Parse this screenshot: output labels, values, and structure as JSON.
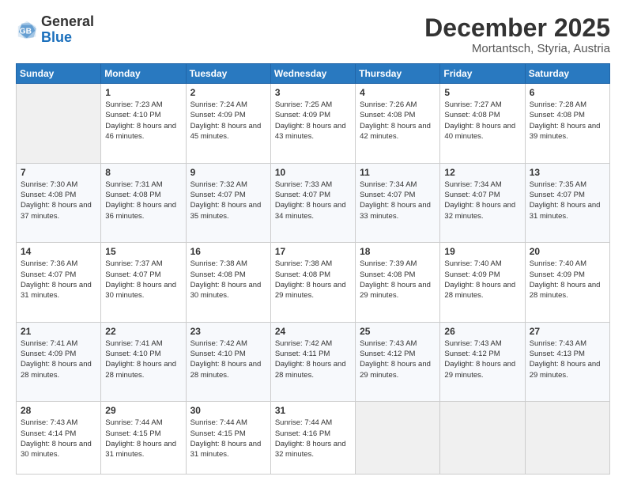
{
  "logo": {
    "general": "General",
    "blue": "Blue"
  },
  "header": {
    "month_year": "December 2025",
    "location": "Mortantsch, Styria, Austria"
  },
  "weekdays": [
    "Sunday",
    "Monday",
    "Tuesday",
    "Wednesday",
    "Thursday",
    "Friday",
    "Saturday"
  ],
  "weeks": [
    [
      {
        "day": "",
        "sunrise": "",
        "sunset": "",
        "daylight": ""
      },
      {
        "day": "1",
        "sunrise": "Sunrise: 7:23 AM",
        "sunset": "Sunset: 4:10 PM",
        "daylight": "Daylight: 8 hours and 46 minutes."
      },
      {
        "day": "2",
        "sunrise": "Sunrise: 7:24 AM",
        "sunset": "Sunset: 4:09 PM",
        "daylight": "Daylight: 8 hours and 45 minutes."
      },
      {
        "day": "3",
        "sunrise": "Sunrise: 7:25 AM",
        "sunset": "Sunset: 4:09 PM",
        "daylight": "Daylight: 8 hours and 43 minutes."
      },
      {
        "day": "4",
        "sunrise": "Sunrise: 7:26 AM",
        "sunset": "Sunset: 4:08 PM",
        "daylight": "Daylight: 8 hours and 42 minutes."
      },
      {
        "day": "5",
        "sunrise": "Sunrise: 7:27 AM",
        "sunset": "Sunset: 4:08 PM",
        "daylight": "Daylight: 8 hours and 40 minutes."
      },
      {
        "day": "6",
        "sunrise": "Sunrise: 7:28 AM",
        "sunset": "Sunset: 4:08 PM",
        "daylight": "Daylight: 8 hours and 39 minutes."
      }
    ],
    [
      {
        "day": "7",
        "sunrise": "Sunrise: 7:30 AM",
        "sunset": "Sunset: 4:08 PM",
        "daylight": "Daylight: 8 hours and 37 minutes."
      },
      {
        "day": "8",
        "sunrise": "Sunrise: 7:31 AM",
        "sunset": "Sunset: 4:08 PM",
        "daylight": "Daylight: 8 hours and 36 minutes."
      },
      {
        "day": "9",
        "sunrise": "Sunrise: 7:32 AM",
        "sunset": "Sunset: 4:07 PM",
        "daylight": "Daylight: 8 hours and 35 minutes."
      },
      {
        "day": "10",
        "sunrise": "Sunrise: 7:33 AM",
        "sunset": "Sunset: 4:07 PM",
        "daylight": "Daylight: 8 hours and 34 minutes."
      },
      {
        "day": "11",
        "sunrise": "Sunrise: 7:34 AM",
        "sunset": "Sunset: 4:07 PM",
        "daylight": "Daylight: 8 hours and 33 minutes."
      },
      {
        "day": "12",
        "sunrise": "Sunrise: 7:34 AM",
        "sunset": "Sunset: 4:07 PM",
        "daylight": "Daylight: 8 hours and 32 minutes."
      },
      {
        "day": "13",
        "sunrise": "Sunrise: 7:35 AM",
        "sunset": "Sunset: 4:07 PM",
        "daylight": "Daylight: 8 hours and 31 minutes."
      }
    ],
    [
      {
        "day": "14",
        "sunrise": "Sunrise: 7:36 AM",
        "sunset": "Sunset: 4:07 PM",
        "daylight": "Daylight: 8 hours and 31 minutes."
      },
      {
        "day": "15",
        "sunrise": "Sunrise: 7:37 AM",
        "sunset": "Sunset: 4:07 PM",
        "daylight": "Daylight: 8 hours and 30 minutes."
      },
      {
        "day": "16",
        "sunrise": "Sunrise: 7:38 AM",
        "sunset": "Sunset: 4:08 PM",
        "daylight": "Daylight: 8 hours and 30 minutes."
      },
      {
        "day": "17",
        "sunrise": "Sunrise: 7:38 AM",
        "sunset": "Sunset: 4:08 PM",
        "daylight": "Daylight: 8 hours and 29 minutes."
      },
      {
        "day": "18",
        "sunrise": "Sunrise: 7:39 AM",
        "sunset": "Sunset: 4:08 PM",
        "daylight": "Daylight: 8 hours and 29 minutes."
      },
      {
        "day": "19",
        "sunrise": "Sunrise: 7:40 AM",
        "sunset": "Sunset: 4:09 PM",
        "daylight": "Daylight: 8 hours and 28 minutes."
      },
      {
        "day": "20",
        "sunrise": "Sunrise: 7:40 AM",
        "sunset": "Sunset: 4:09 PM",
        "daylight": "Daylight: 8 hours and 28 minutes."
      }
    ],
    [
      {
        "day": "21",
        "sunrise": "Sunrise: 7:41 AM",
        "sunset": "Sunset: 4:09 PM",
        "daylight": "Daylight: 8 hours and 28 minutes."
      },
      {
        "day": "22",
        "sunrise": "Sunrise: 7:41 AM",
        "sunset": "Sunset: 4:10 PM",
        "daylight": "Daylight: 8 hours and 28 minutes."
      },
      {
        "day": "23",
        "sunrise": "Sunrise: 7:42 AM",
        "sunset": "Sunset: 4:10 PM",
        "daylight": "Daylight: 8 hours and 28 minutes."
      },
      {
        "day": "24",
        "sunrise": "Sunrise: 7:42 AM",
        "sunset": "Sunset: 4:11 PM",
        "daylight": "Daylight: 8 hours and 28 minutes."
      },
      {
        "day": "25",
        "sunrise": "Sunrise: 7:43 AM",
        "sunset": "Sunset: 4:12 PM",
        "daylight": "Daylight: 8 hours and 29 minutes."
      },
      {
        "day": "26",
        "sunrise": "Sunrise: 7:43 AM",
        "sunset": "Sunset: 4:12 PM",
        "daylight": "Daylight: 8 hours and 29 minutes."
      },
      {
        "day": "27",
        "sunrise": "Sunrise: 7:43 AM",
        "sunset": "Sunset: 4:13 PM",
        "daylight": "Daylight: 8 hours and 29 minutes."
      }
    ],
    [
      {
        "day": "28",
        "sunrise": "Sunrise: 7:43 AM",
        "sunset": "Sunset: 4:14 PM",
        "daylight": "Daylight: 8 hours and 30 minutes."
      },
      {
        "day": "29",
        "sunrise": "Sunrise: 7:44 AM",
        "sunset": "Sunset: 4:15 PM",
        "daylight": "Daylight: 8 hours and 31 minutes."
      },
      {
        "day": "30",
        "sunrise": "Sunrise: 7:44 AM",
        "sunset": "Sunset: 4:15 PM",
        "daylight": "Daylight: 8 hours and 31 minutes."
      },
      {
        "day": "31",
        "sunrise": "Sunrise: 7:44 AM",
        "sunset": "Sunset: 4:16 PM",
        "daylight": "Daylight: 8 hours and 32 minutes."
      },
      {
        "day": "",
        "sunrise": "",
        "sunset": "",
        "daylight": ""
      },
      {
        "day": "",
        "sunrise": "",
        "sunset": "",
        "daylight": ""
      },
      {
        "day": "",
        "sunrise": "",
        "sunset": "",
        "daylight": ""
      }
    ]
  ]
}
